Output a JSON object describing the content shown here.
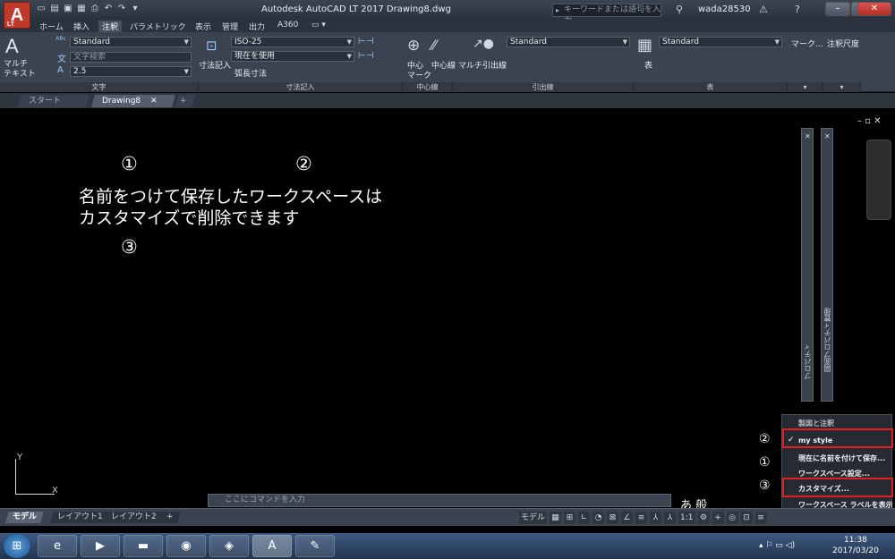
{
  "titlebar": {
    "app_title": "Autodesk AutoCAD LT 2017    Drawing8.dwg",
    "search_placeholder": "キーワードまたは語句を入力",
    "user": "wada28530",
    "app_letter": "A",
    "app_badge": "LT"
  },
  "ribbon_tabs": [
    "ホーム",
    "挿入",
    "注釈",
    "パラメトリック",
    "表示",
    "管理",
    "出力",
    "A360"
  ],
  "ribbon": {
    "text_style": "Standard",
    "text_search": "文字検索",
    "text_height": "2.5",
    "big_text_label_1": "マルチ",
    "big_text_label_2": "テキスト",
    "dim_label": "寸法記入",
    "dim_style": "ISO-25",
    "dim_layer": "現在を使用",
    "dim_sub": "弧長寸法",
    "center_label_1": "中心",
    "center_label_2": "マーク",
    "centerline_label": "中心線",
    "mleader_label": "マルチ引出線",
    "mleader_style": "Standard",
    "table_label": "表",
    "table_style": "Standard",
    "markup_label": "マーク...",
    "annoscale_label": "注釈尺度",
    "panels": [
      "文字",
      "寸法記入",
      "中心線",
      "引出線",
      "表"
    ]
  },
  "doc_tabs": {
    "start": "スタート",
    "active": "Drawing8"
  },
  "annotations": {
    "n1": "①",
    "n2": "②",
    "n3": "③",
    "line1": "名前をつけて保存したワークスペースは",
    "line2": "カスタマイズで削除できます"
  },
  "palettes": {
    "properties": "プロパティ",
    "drawing_properties": "図面プロパティ管理"
  },
  "ucs": {
    "y": "Y",
    "x": "X"
  },
  "workspace_menu": {
    "header": "製図と注釈",
    "items": [
      "my style",
      "現在に名前を付けて保存...",
      "ワークスペース設定...",
      "カスタマイズ...",
      "ワークスペース ラベルを表示"
    ],
    "checked_item": "my style",
    "numbers": [
      "②",
      "①",
      "③"
    ]
  },
  "command_line": {
    "placeholder": "ここにコマンドを入力"
  },
  "status_tabs": [
    "モデル",
    "レイアウト1",
    "レイアウト2"
  ],
  "status_bar": {
    "model_label": "モデル",
    "scale": "1:1"
  },
  "ime": "あ 般",
  "clock": {
    "time": "11:38",
    "date": "2017/03/20"
  },
  "colors": {
    "highlight_box": "#e02020",
    "canvas": "#000000",
    "ribbon": "#3b4350"
  }
}
